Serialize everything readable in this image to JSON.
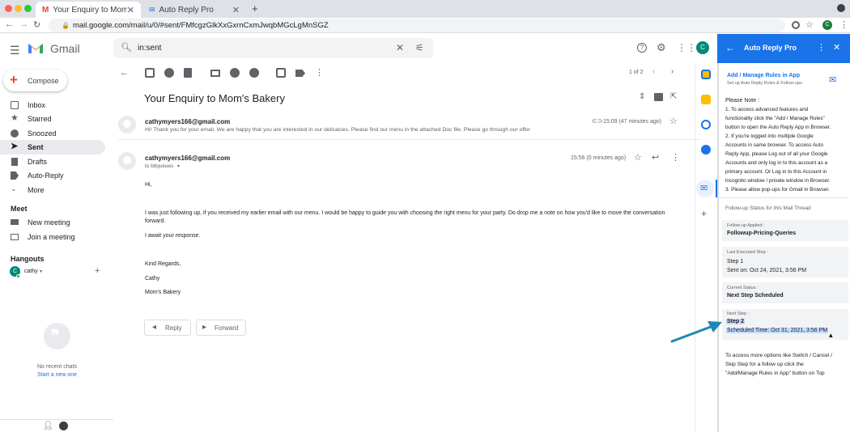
{
  "browser": {
    "tabs": [
      {
        "title": "Your Enquiry to Mom's Bakery",
        "active": true
      },
      {
        "title": "Auto Reply Pro",
        "active": false
      }
    ],
    "url": "mail.google.com/mail/u/0/#sent/FMfcgzGlkXxGxrnCxmJwqbMGcLgMnSGZ",
    "profile_initial": "C"
  },
  "gmail": {
    "brand": "Gmail",
    "search_query": "in:sent",
    "compose_label": "Compose",
    "nav": [
      {
        "label": "Inbox",
        "icon": "inbox-icon"
      },
      {
        "label": "Starred",
        "icon": "star-icon"
      },
      {
        "label": "Snoozed",
        "icon": "clock-icon"
      },
      {
        "label": "Sent",
        "icon": "send-icon",
        "active": true
      },
      {
        "label": "Drafts",
        "icon": "draft-icon"
      },
      {
        "label": "Auto-Reply",
        "icon": "label-icon"
      },
      {
        "label": "More",
        "icon": "chevron-down-icon"
      }
    ],
    "meet": {
      "heading": "Meet",
      "items": [
        {
          "label": "New meeting",
          "icon": "video-icon"
        },
        {
          "label": "Join a meeting",
          "icon": "keyboard-icon"
        }
      ]
    },
    "hangouts": {
      "heading": "Hangouts",
      "user": "cathy",
      "user_initial": "C",
      "no_chats": "No recent chats",
      "start_new": "Start a new one"
    },
    "pagination": "1 of 2",
    "account_initial": "C",
    "thread": {
      "subject": "Your Enquiry to Mom's Bakery",
      "messages": [
        {
          "sender": "cathymyers166@gmail.com",
          "snippet": "Hi! Thank you for your email. We are happy that you are interested in our delicacies. Please find our menu in the attached Doc file. Please go through our offer",
          "time": "15:09 (47 minutes ago)"
        },
        {
          "sender": "cathymyers166@gmail.com",
          "to": "to bitqueues",
          "time": "15:56 (0 minutes ago)",
          "body": [
            "Hi,",
            "I was just following up, if you received my earlier email with our menu. I would be happy to guide you with choosing the right menu for your party. Do drop me a note on how you'd like to move the conversation forward.",
            "I await your response.",
            "Kind Regards,",
            "Cathy",
            "Mom's Bakery"
          ]
        }
      ],
      "reply_label": "Reply",
      "forward_label": "Forward"
    }
  },
  "panel": {
    "title": "Auto Reply Pro",
    "manage_link": "Add / Manage Rules in App",
    "manage_sub": "Set up Auto Reply Rules & Follow-ups",
    "note_heading": "Please Note :",
    "note_lines": [
      "1. To access advanced features and",
      "functionality click the \"Add / Manage Rules\"",
      "button to open the Auto Reply App in Browser.",
      "2. If you're logged into multiple Google",
      "Accounts in same browser. To access Auto",
      "Reply App, please Log out of all your Google",
      "Accounts and only log in to this account as a",
      "primary account. Or Log in to this Account in",
      "incognito window / private window in Browser.",
      "3. Please allow pop-ups for Gmail in Browser."
    ],
    "status_heading": "Follow-up Status for this Mail Thread",
    "followup_label": "Follow-up Applied :",
    "followup_value": "Followup-Pricing-Queries",
    "last_label": "Last Executed Step :",
    "last_step": "Step 1",
    "last_sent": "Sent on: Oct 24, 2021, 3:56 PM",
    "current_label": "Current Status :",
    "current_value": "Next Step Scheduled",
    "next_label": "Next Step :",
    "next_step": "Step 2",
    "next_time": "Scheduled Time: Oct 31, 2021, 3:56 PM",
    "footer_lines": [
      "To access more options like Switch / Cancel /",
      "Skip Step for a follow up click the",
      "\"Add/Manage Rules in App\" button on Top"
    ]
  },
  "colors": {
    "accent": "#1a73e8",
    "arrow": "#1f87b5",
    "highlight": "#c6dafc"
  }
}
